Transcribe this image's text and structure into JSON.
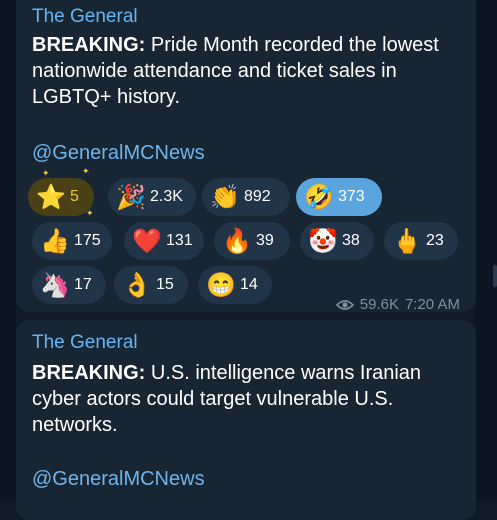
{
  "messages": [
    {
      "author": "The General",
      "headline": "BREAKING:",
      "body": " Pride Month recorded the lowest nationwide attendance and ticket sales in LGBTQ+ history.",
      "handle": "@GeneralMCNews",
      "reactions": [
        {
          "icon": "⭐",
          "count": "5"
        },
        {
          "icon": "🎉",
          "count": "2.3K"
        },
        {
          "icon": "👏",
          "count": "892"
        },
        {
          "icon": "🤣",
          "count": "373"
        },
        {
          "icon": "👍",
          "count": "175"
        },
        {
          "icon": "❤️",
          "count": "131"
        },
        {
          "icon": "🔥",
          "count": "39"
        },
        {
          "icon": "🤡",
          "count": "38"
        },
        {
          "icon": "🖕",
          "count": "23"
        },
        {
          "icon": "🦄",
          "count": "17"
        },
        {
          "icon": "👌",
          "count": "15"
        },
        {
          "icon": "😁",
          "count": "14"
        }
      ],
      "views": "59.6K",
      "time": "7:20 AM"
    },
    {
      "author": "The General",
      "headline": "BREAKING:",
      "body": " U.S. intelligence warns Iranian cyber actors could target vulnerable U.S. networks.",
      "handle": "@GeneralMCNews"
    }
  ]
}
